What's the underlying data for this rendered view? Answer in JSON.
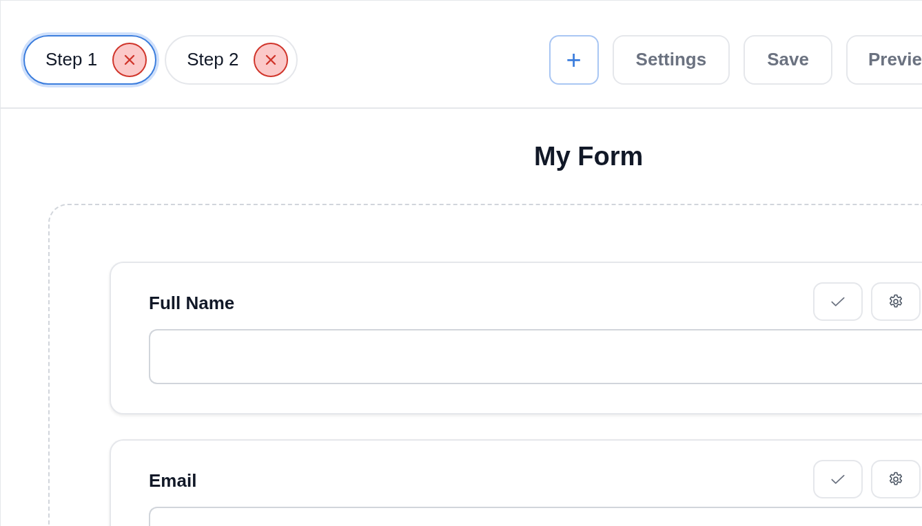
{
  "tabs": [
    {
      "label": "Step 1",
      "selected": true
    },
    {
      "label": "Step 2",
      "selected": false
    }
  ],
  "toolbar": {
    "add": "+",
    "buttons": [
      "Settings",
      "Save",
      "Previe"
    ]
  },
  "form": {
    "title": "My Form",
    "fields": [
      {
        "label": "Full Name"
      },
      {
        "label": "Email"
      }
    ]
  }
}
